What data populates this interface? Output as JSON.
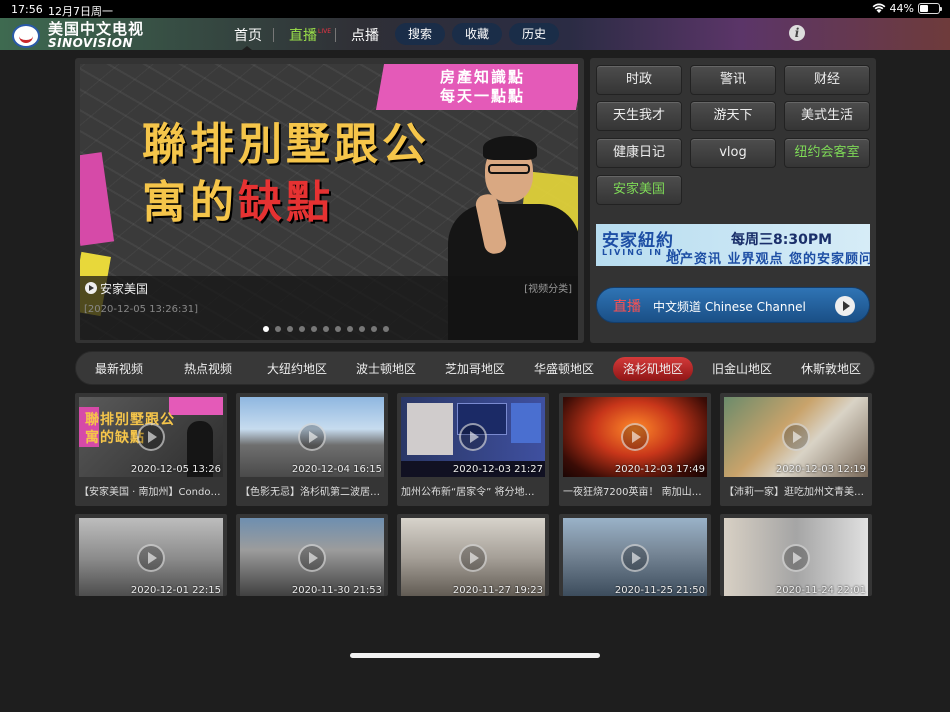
{
  "status_bar": {
    "time": "17:56",
    "date": "12月7日周一",
    "battery": "44%"
  },
  "nav": {
    "logo_cn": "美国中文电视",
    "logo_en": "SINOVISION",
    "links": [
      {
        "label": "首页"
      },
      {
        "label": "直播",
        "badge": "LIVE"
      },
      {
        "label": "点播"
      }
    ],
    "pills": [
      {
        "label": "搜索"
      },
      {
        "label": "收藏"
      },
      {
        "label": "历史"
      }
    ],
    "info_label": "i"
  },
  "banner": {
    "tagline_1": "房產知識點",
    "tagline_2": "每天一點點",
    "headline_1": "聯排別墅跟公",
    "headline_2a": "寓的",
    "headline_2b": "缺點",
    "title": "安家美国",
    "category": "[视频分类]",
    "date": "[2020-12-05 13:26:31]",
    "dot_count": 11,
    "active_dot": 0
  },
  "categories": [
    {
      "label": "时政"
    },
    {
      "label": "警讯"
    },
    {
      "label": "财经"
    },
    {
      "label": "天生我才"
    },
    {
      "label": "游天下"
    },
    {
      "label": "美式生活"
    },
    {
      "label": "健康日记"
    },
    {
      "label": "vlog"
    },
    {
      "label": "纽约会客室",
      "highlight": true
    },
    {
      "label": "安家美国",
      "highlight": true
    }
  ],
  "ad": {
    "logo": "安家紐約",
    "logo_sub": "LIVING IN NY",
    "time": "每周三8:30PM",
    "sub": "地产资讯 业界观点 您的安家顾问"
  },
  "live": {
    "label": "直播",
    "channel": "中文频道 Chinese Channel"
  },
  "tabs": [
    {
      "label": "最新视频"
    },
    {
      "label": "热点视频"
    },
    {
      "label": "大纽约地区"
    },
    {
      "label": "波士顿地区"
    },
    {
      "label": "芝加哥地区"
    },
    {
      "label": "华盛顿地区"
    },
    {
      "label": "洛杉矶地区",
      "active": true
    },
    {
      "label": "旧金山地区"
    },
    {
      "label": "休斯敦地区"
    }
  ],
  "videos": [
    {
      "date": "2020-12-05 13:26",
      "title": "【安家美国 · 南加州】Condo…",
      "thumb_text_1": "聯排別墅跟公",
      "thumb_text_2": "寓的缺點"
    },
    {
      "date": "2020-12-04 16:15",
      "title": "【色影无忌】洛杉矶第二波居…"
    },
    {
      "date": "2020-12-03 21:27",
      "title": "加州公布新“居家令” 将分地…"
    },
    {
      "date": "2020-12-03 17:49",
      "title": "一夜狂烧7200英亩！ 南加山…"
    },
    {
      "date": "2020-12-03 12:19",
      "title": "【沛莉一家】逛吃加州文青美…"
    },
    {
      "date": "2020-12-01 22:15",
      "title": ""
    },
    {
      "date": "2020-11-30 21:53",
      "title": ""
    },
    {
      "date": "2020-11-27 19:23",
      "title": ""
    },
    {
      "date": "2020-11-25 21:50",
      "title": ""
    },
    {
      "date": "2020-11-24 22:01",
      "title": ""
    }
  ]
}
